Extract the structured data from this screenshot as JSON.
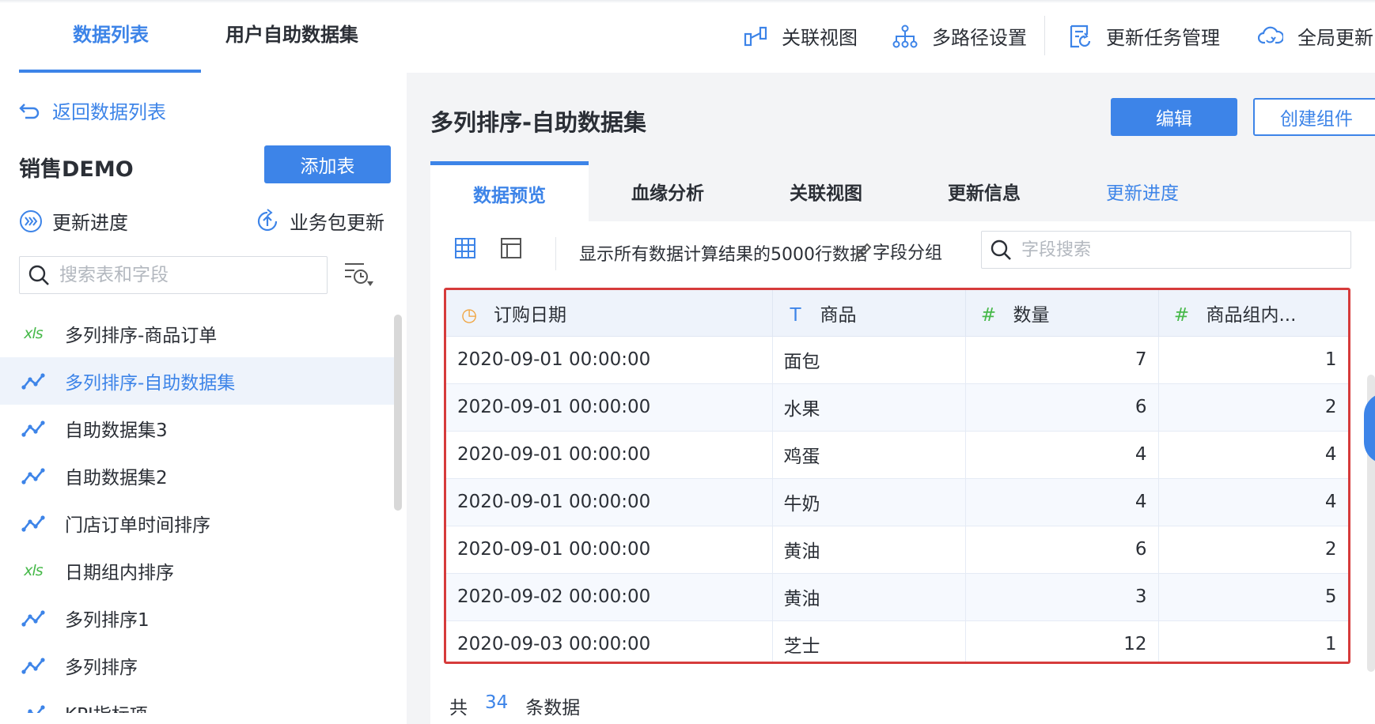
{
  "top_tabs": [
    {
      "label": "数据列表",
      "active": true
    },
    {
      "label": "用户自助数据集",
      "active": false
    }
  ],
  "top_actions": [
    {
      "label": "关联视图",
      "icon": "relation-view-icon"
    },
    {
      "label": "多路径设置",
      "icon": "multi-path-icon"
    },
    {
      "label": "更新任务管理",
      "icon": "update-task-icon"
    },
    {
      "label": "全局更新",
      "icon": "cloud-refresh-icon"
    }
  ],
  "sidebar": {
    "back_label": "返回数据列表",
    "package_title": "销售DEMO",
    "add_table_label": "添加表",
    "update_progress_label": "更新进度",
    "package_update_label": "业务包更新",
    "search_placeholder": "搜索表和字段",
    "items": [
      {
        "label": "多列排序-商品订单",
        "type": "xls",
        "active": false
      },
      {
        "label": "多列排序-自助数据集",
        "type": "dataset",
        "active": true
      },
      {
        "label": "自助数据集3",
        "type": "dataset",
        "active": false
      },
      {
        "label": "自助数据集2",
        "type": "dataset",
        "active": false
      },
      {
        "label": "门店订单时间排序",
        "type": "dataset",
        "active": false
      },
      {
        "label": "日期组内排序",
        "type": "xls",
        "active": false
      },
      {
        "label": "多列排序1",
        "type": "dataset",
        "active": false
      },
      {
        "label": "多列排序",
        "type": "dataset",
        "active": false
      },
      {
        "label": "KPI指标项",
        "type": "dataset",
        "active": false
      }
    ]
  },
  "main": {
    "title": "多列排序-自助数据集",
    "edit_label": "编辑",
    "create_component_label": "创建组件",
    "tabs": [
      {
        "label": "数据预览",
        "active": true
      },
      {
        "label": "血缘分析",
        "active": false
      },
      {
        "label": "关联视图",
        "active": false
      },
      {
        "label": "更新信息",
        "active": false
      },
      {
        "label": "更新进度",
        "active": false,
        "link": true
      }
    ],
    "toolbar_text": "显示所有数据计算结果的5000行数据",
    "field_group_label": "字段分组",
    "field_search_placeholder": "字段搜索",
    "table": {
      "headers": [
        {
          "label": "订购日期",
          "type_icon": "clock-icon",
          "type_symbol": "◷"
        },
        {
          "label": "商品",
          "type_icon": "text-type-icon",
          "type_symbol": "T"
        },
        {
          "label": "数量",
          "type_icon": "number-type-icon",
          "type_symbol": "#"
        },
        {
          "label": "商品组内...",
          "type_icon": "number-type-icon",
          "type_symbol": "#"
        }
      ],
      "rows": [
        [
          "2020-09-01 00:00:00",
          "面包",
          "7",
          "1"
        ],
        [
          "2020-09-01 00:00:00",
          "水果",
          "6",
          "2"
        ],
        [
          "2020-09-01 00:00:00",
          "鸡蛋",
          "4",
          "4"
        ],
        [
          "2020-09-01 00:00:00",
          "牛奶",
          "4",
          "4"
        ],
        [
          "2020-09-01 00:00:00",
          "黄油",
          "6",
          "2"
        ],
        [
          "2020-09-02 00:00:00",
          "黄油",
          "3",
          "5"
        ],
        [
          "2020-09-03 00:00:00",
          "芝士",
          "12",
          "1"
        ]
      ]
    },
    "footer": {
      "prefix": "共",
      "count": "34",
      "suffix": "条数据"
    }
  },
  "colors": {
    "accent": "#3d84e8",
    "highlight_border": "#d63b3b",
    "xls_green": "#47b94a"
  }
}
